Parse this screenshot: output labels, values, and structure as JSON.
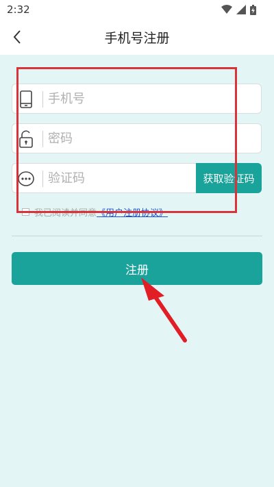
{
  "status_bar": {
    "time": "2:32",
    "icons": [
      "wifi-icon",
      "signal-icon",
      "battery-icon"
    ]
  },
  "app_bar": {
    "back_icon": "chevron-left-icon",
    "title": "手机号注册"
  },
  "form": {
    "phone": {
      "placeholder": "手机号",
      "value": "",
      "icon": "phone-icon"
    },
    "password": {
      "placeholder": "密码",
      "value": "",
      "icon": "unlock-icon"
    },
    "code": {
      "placeholder": "验证码",
      "value": "",
      "icon": "chat-dots-icon",
      "button_label": "获取验证码"
    },
    "agreement": {
      "checked": false,
      "prefix": "我已阅读并同意",
      "link_text": "《用户注册协议》"
    }
  },
  "register_button": {
    "label": "注册"
  },
  "colors": {
    "accent": "#19a39a",
    "background": "#e3f6f5",
    "link": "#1f4fd1",
    "annotation": "#d93238"
  }
}
